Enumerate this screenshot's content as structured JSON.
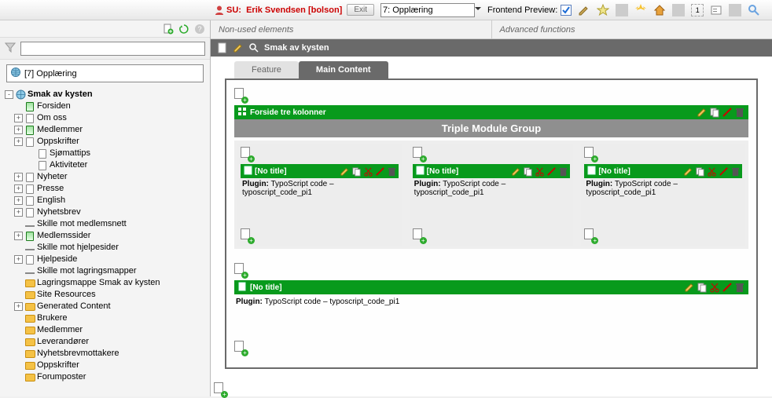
{
  "top": {
    "su_label": "SU:",
    "su_user": "Erik Svendsen [bolson]",
    "exit": "Exit",
    "site_selector": "7: Opplæring",
    "frontend_preview": "Frontend Preview:",
    "cache_badge": "1"
  },
  "sidebar": {
    "root": "[7] Opplæring"
  },
  "tree": [
    {
      "indent": 0,
      "toggle": "-",
      "icon": "globe",
      "label": "Smak av kysten",
      "selected": true
    },
    {
      "indent": 1,
      "toggle": "",
      "icon": "pagegreen",
      "label": "Forsiden"
    },
    {
      "indent": 1,
      "toggle": "+",
      "icon": "page",
      "label": "Om oss"
    },
    {
      "indent": 1,
      "toggle": "+",
      "icon": "pagegreen",
      "label": "Medlemmer"
    },
    {
      "indent": 1,
      "toggle": "+",
      "icon": "page",
      "label": "Oppskrifter"
    },
    {
      "indent": 2,
      "toggle": "",
      "icon": "page",
      "label": "Sjømattips"
    },
    {
      "indent": 2,
      "toggle": "",
      "icon": "page",
      "label": "Aktiviteter"
    },
    {
      "indent": 1,
      "toggle": "+",
      "icon": "page",
      "label": "Nyheter"
    },
    {
      "indent": 1,
      "toggle": "+",
      "icon": "page",
      "label": "Presse"
    },
    {
      "indent": 1,
      "toggle": "+",
      "icon": "page",
      "label": "English"
    },
    {
      "indent": 1,
      "toggle": "+",
      "icon": "page",
      "label": "Nyhetsbrev"
    },
    {
      "indent": 1,
      "toggle": "",
      "icon": "sep",
      "label": "Skille mot medlemsnett"
    },
    {
      "indent": 1,
      "toggle": "+",
      "icon": "pagegreen",
      "label": "Medlemssider"
    },
    {
      "indent": 1,
      "toggle": "",
      "icon": "sep",
      "label": "Skille mot hjelpesider"
    },
    {
      "indent": 1,
      "toggle": "+",
      "icon": "page",
      "label": "Hjelpeside"
    },
    {
      "indent": 1,
      "toggle": "",
      "icon": "sep",
      "label": "Skille mot lagringsmapper"
    },
    {
      "indent": 1,
      "toggle": "",
      "icon": "folder",
      "label": "Lagringsmappe Smak av kysten"
    },
    {
      "indent": 1,
      "toggle": "",
      "icon": "folder",
      "label": "Site Resources"
    },
    {
      "indent": 1,
      "toggle": "+",
      "icon": "folder",
      "label": "Generated Content"
    },
    {
      "indent": 1,
      "toggle": "",
      "icon": "folder",
      "label": "Brukere"
    },
    {
      "indent": 1,
      "toggle": "",
      "icon": "folder",
      "label": "Medlemmer"
    },
    {
      "indent": 1,
      "toggle": "",
      "icon": "folder",
      "label": "Leverandører"
    },
    {
      "indent": 1,
      "toggle": "",
      "icon": "folder",
      "label": "Nyhetsbrevmottakere"
    },
    {
      "indent": 1,
      "toggle": "",
      "icon": "folder",
      "label": "Oppskrifter"
    },
    {
      "indent": 1,
      "toggle": "",
      "icon": "folder",
      "label": "Forumposter"
    }
  ],
  "functabs": {
    "nonused": "Non-used elements",
    "advanced": "Advanced functions"
  },
  "page_title": "Smak av kysten",
  "ctabs": {
    "feature": "Feature",
    "maincontent": "Main Content"
  },
  "section": {
    "title": "Forside tre kolonner",
    "group_title": "Triple Module Group"
  },
  "card": {
    "no_title": "[No title]",
    "plugin_label": "Plugin:",
    "plugin_value": "TypoScript code – typoscript_code_pi1"
  }
}
